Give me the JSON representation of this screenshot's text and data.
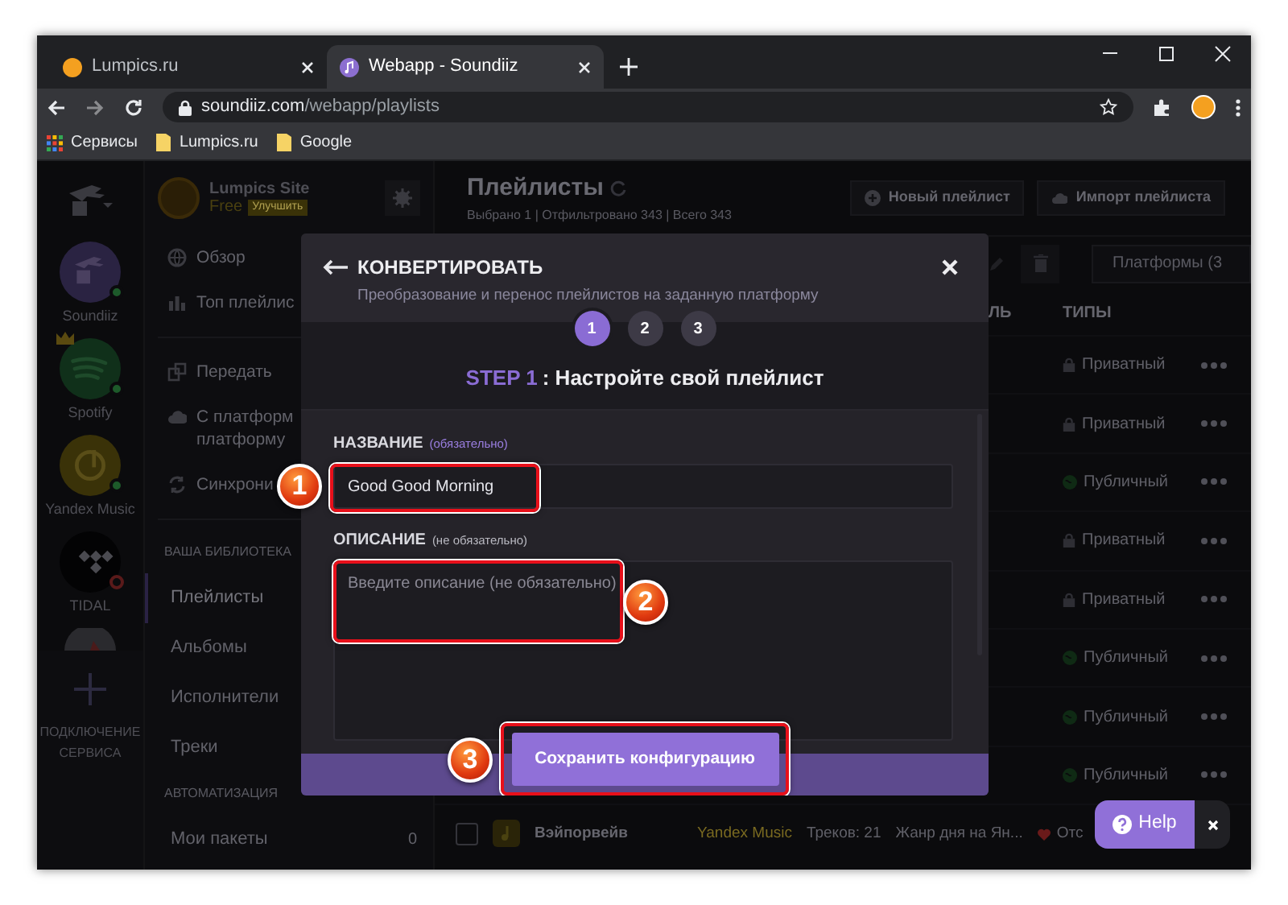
{
  "browser": {
    "tabs": [
      {
        "title": "Lumpics.ru",
        "kind": "orange",
        "selected": false
      },
      {
        "title": "Webapp - Soundiiz",
        "kind": "purple",
        "selected": true
      }
    ],
    "url_host": "soundiiz.com",
    "url_path": "/webapp/playlists",
    "bookmarks": [
      {
        "label": "Сервисы",
        "kind": "apps"
      },
      {
        "label": "Lumpics.ru",
        "kind": "folder"
      },
      {
        "label": "Google",
        "kind": "folder"
      }
    ]
  },
  "services": [
    {
      "name": "Soundiiz",
      "kind": "soundiiz",
      "connected": true,
      "premium": false
    },
    {
      "name": "Spotify",
      "kind": "spotify",
      "connected": true,
      "premium": true
    },
    {
      "name": "Yandex Music",
      "kind": "yandex",
      "connected": true,
      "premium": false
    },
    {
      "name": "TIDAL",
      "kind": "tidal",
      "connected": false,
      "premium": false
    }
  ],
  "add_service": "ПОДКЛЮЧЕНИЕ СЕРВИСА",
  "account": {
    "name": "Lumpics Site",
    "plan": "Free",
    "upgrade": "Улучшить"
  },
  "nav": [
    {
      "kind": "link",
      "lines": [
        "Обзор"
      ]
    },
    {
      "kind": "link",
      "lines": [
        "Топ плейлис"
      ]
    },
    {
      "kind": "divider"
    },
    {
      "kind": "link",
      "lines": [
        "Передать"
      ]
    },
    {
      "kind": "link",
      "lines": [
        "С платформ",
        "платформу"
      ]
    },
    {
      "kind": "link",
      "lines": [
        "Синхрони"
      ]
    },
    {
      "kind": "divider"
    },
    {
      "kind": "heading",
      "lines": [
        "ВАША БИБЛИОТЕКА"
      ]
    },
    {
      "kind": "library",
      "lines": [
        "Плейлисты"
      ],
      "selected": true
    },
    {
      "kind": "library",
      "lines": [
        "Альбомы"
      ],
      "selected": false
    },
    {
      "kind": "library",
      "lines": [
        "Исполнители"
      ],
      "selected": false
    },
    {
      "kind": "library",
      "lines": [
        "Треки"
      ],
      "selected": false
    },
    {
      "kind": "heading",
      "lines": [
        "АВТОМАТИЗАЦИЯ"
      ]
    },
    {
      "kind": "library",
      "lines": [
        "Мои пакеты"
      ],
      "count": "0",
      "selected": false
    }
  ],
  "main": {
    "title": "Плейлисты",
    "subtitle": "Выбрано 1 | Отфильтровано 343 | Всего 343",
    "buttons": [
      {
        "label": "Новый плейлист"
      },
      {
        "label": "Импорт плейлиста"
      }
    ],
    "filter": "Платформы (3",
    "columns": {
      "column_1": "ЛЬ",
      "types": "ТИПЫ"
    },
    "rows": [
      {
        "type": "Приватный",
        "public": false
      },
      {
        "type": "Приватный",
        "public": false
      },
      {
        "type": "Публичный",
        "public": true
      },
      {
        "type": "Приватный",
        "public": false
      },
      {
        "type": "Приватный",
        "public": false
      },
      {
        "type": "Публичный",
        "public": true
      },
      {
        "type": "Публичный",
        "public": true
      },
      {
        "type": "Публичный",
        "public": true
      }
    ],
    "last_row": {
      "checked": false,
      "name": "Вэйпорвейв",
      "platform": "Yandex Music",
      "tracks": "Треков: 21",
      "description": "Жанр дня на Ян...",
      "column_5": "Отс"
    }
  },
  "modal": {
    "title": "КОНВЕРТИРОВАТЬ",
    "subtitle": "Преобразование и перенос плейлистов на заданную платформу",
    "steps": [
      {
        "label": "1",
        "selected": true
      },
      {
        "label": "2",
        "selected": false
      },
      {
        "label": "3",
        "selected": false
      }
    ],
    "step_label": "STEP 1",
    "step_title": ": Настройте свой плейлист",
    "name_label": "НАЗВАНИЕ",
    "name_hint": "(обязательно)",
    "name_value": "Good Good Morning",
    "description_label": "ОПИСАНИЕ",
    "description_hint": "(не обязательно)",
    "description_placeholder": "Введите описание (не обязательно)",
    "save": "Сохранить конфигурацию"
  },
  "annotations": [
    "1",
    "2",
    "3"
  ],
  "help": "Help"
}
